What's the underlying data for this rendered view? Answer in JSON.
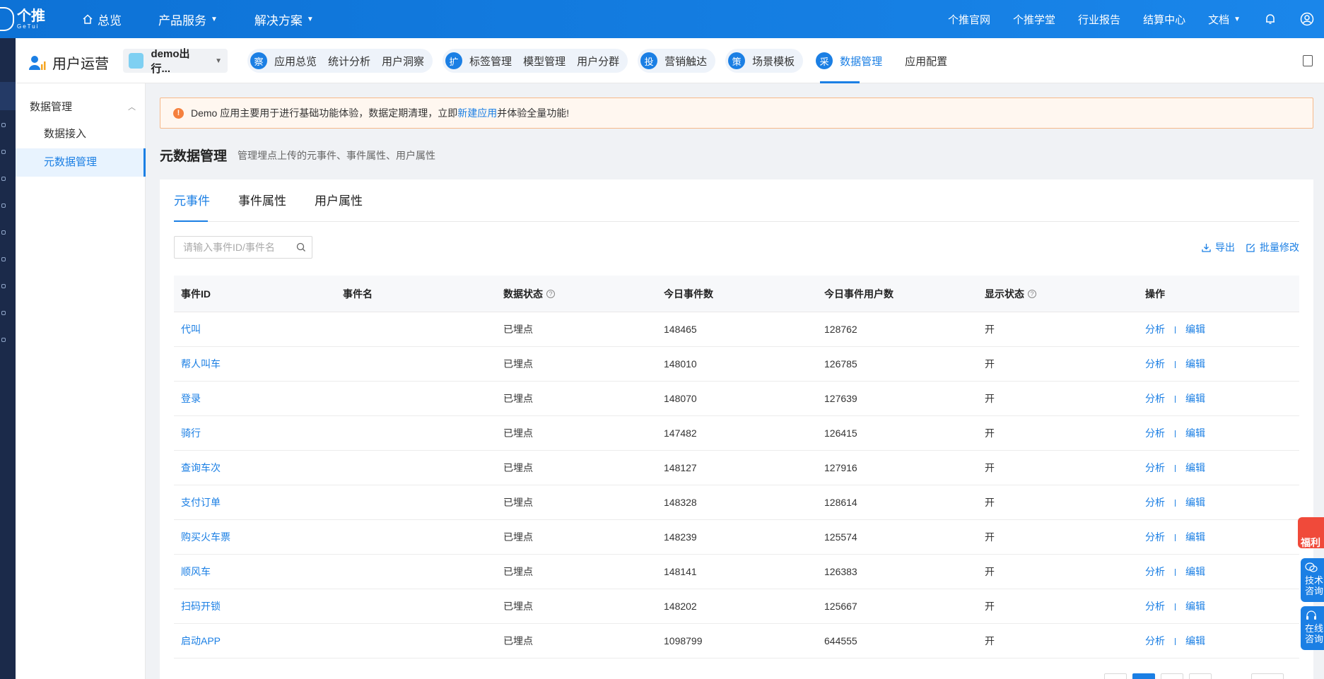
{
  "topbar": {
    "logo_text": "个推",
    "logo_sub": "GeTui",
    "main_nav": [
      {
        "label": "总览",
        "has_caret": false
      },
      {
        "label": "产品服务",
        "has_caret": true
      },
      {
        "label": "解决方案",
        "has_caret": true
      }
    ],
    "right_nav": [
      {
        "label": "个推官网"
      },
      {
        "label": "个推学堂"
      },
      {
        "label": "行业报告"
      },
      {
        "label": "结算中心"
      },
      {
        "label": "文档"
      }
    ]
  },
  "subheader": {
    "title": "用户运营",
    "app_select_value": "demo出行...",
    "groups": [
      {
        "badge": "察",
        "items": [
          "应用总览",
          "统计分析",
          "用户洞察"
        ]
      },
      {
        "badge": "扩",
        "items": [
          "标签管理",
          "模型管理",
          "用户分群"
        ]
      },
      {
        "badge": "投",
        "items": [
          "营销触达"
        ]
      },
      {
        "badge": "策",
        "items": [
          "场景模板"
        ]
      },
      {
        "badge": "采",
        "items": [
          "数据管理"
        ]
      }
    ],
    "plain_item": "应用配置"
  },
  "sidemenu": {
    "group_label": "数据管理",
    "items": [
      {
        "label": "数据接入"
      },
      {
        "label": "元数据管理"
      }
    ]
  },
  "notice": {
    "before": "Demo 应用主要用于进行基础功能体验，数据定期清理，立即",
    "link": "新建应用",
    "after": "并体验全量功能!"
  },
  "page": {
    "title": "元数据管理",
    "description": "管理埋点上传的元事件、事件属性、用户属性"
  },
  "tabs": [
    {
      "label": "元事件"
    },
    {
      "label": "事件属性"
    },
    {
      "label": "用户属性"
    }
  ],
  "search": {
    "placeholder": "请输入事件ID/事件名"
  },
  "actions": {
    "export": "导出",
    "batch_edit": "批量修改"
  },
  "table": {
    "headers": [
      "事件ID",
      "事件名",
      "数据状态",
      "今日事件数",
      "今日事件用户数",
      "显示状态",
      "操作"
    ],
    "action_labels": {
      "analyze": "分析",
      "edit": "编辑"
    },
    "rows": [
      {
        "id": "代叫",
        "name": "",
        "status": "已埋点",
        "count": "148465",
        "users": "128762",
        "display": "开"
      },
      {
        "id": "帮人叫车",
        "name": "",
        "status": "已埋点",
        "count": "148010",
        "users": "126785",
        "display": "开"
      },
      {
        "id": "登录",
        "name": "",
        "status": "已埋点",
        "count": "148070",
        "users": "127639",
        "display": "开"
      },
      {
        "id": "骑行",
        "name": "",
        "status": "已埋点",
        "count": "147482",
        "users": "126415",
        "display": "开"
      },
      {
        "id": "查询车次",
        "name": "",
        "status": "已埋点",
        "count": "148127",
        "users": "127916",
        "display": "开"
      },
      {
        "id": "支付订单",
        "name": "",
        "status": "已埋点",
        "count": "148328",
        "users": "128614",
        "display": "开"
      },
      {
        "id": "购买火车票",
        "name": "",
        "status": "已埋点",
        "count": "148239",
        "users": "125574",
        "display": "开"
      },
      {
        "id": "顺风车",
        "name": "",
        "status": "已埋点",
        "count": "148141",
        "users": "126383",
        "display": "开"
      },
      {
        "id": "扫码开锁",
        "name": "",
        "status": "已埋点",
        "count": "148202",
        "users": "125667",
        "display": "开"
      },
      {
        "id": "启动APP",
        "name": "",
        "status": "已埋点",
        "count": "1098799",
        "users": "644555",
        "display": "开"
      }
    ]
  },
  "floating": {
    "gift": "福利",
    "tech": "技术咨询",
    "online": "在线咨询"
  },
  "colors": {
    "primary": "#1b7fe4",
    "topbar": "#0d72d6",
    "warning": "#f5803e"
  }
}
